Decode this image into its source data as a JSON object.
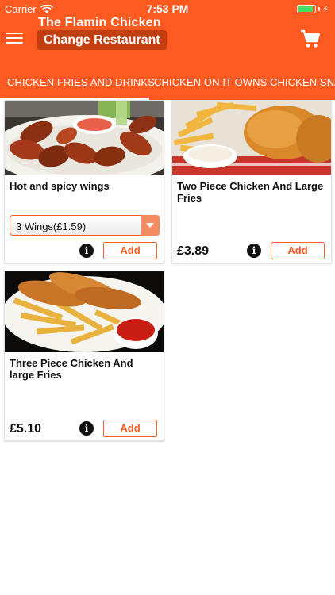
{
  "status_bar": {
    "carrier": "Carrier",
    "time": "7:53 PM",
    "battery_icon": "battery-icon",
    "wifi_icon": "wifi-icon"
  },
  "header": {
    "restaurant_name": "The Flamin Chicken",
    "change_button": "Change Restaurant",
    "menu_icon": "hamburger-menu-icon",
    "cart_icon": "cart-icon",
    "brand_color": "#fd5a22"
  },
  "tabs": [
    {
      "label": "CHICKEN FRIES AND DRINKS",
      "active": true
    },
    {
      "label": "CHICKEN ON IT OWNS",
      "active": false
    },
    {
      "label": "CHICKEN SNA",
      "active": false
    }
  ],
  "products": [
    {
      "title": "Hot and spicy wings",
      "option": "3 Wings(£1.59)",
      "add_label": "Add",
      "image": "chicken wings with dip"
    },
    {
      "title": "Two Piece Chicken And Large Fries",
      "price": "£3.89",
      "add_label": "Add",
      "image": "fried chicken and fries"
    },
    {
      "title": "Three Piece Chicken And large Fries",
      "price": "£5.10",
      "add_label": "Add",
      "image": "chicken strips with fries"
    }
  ],
  "info_symbol": "i"
}
